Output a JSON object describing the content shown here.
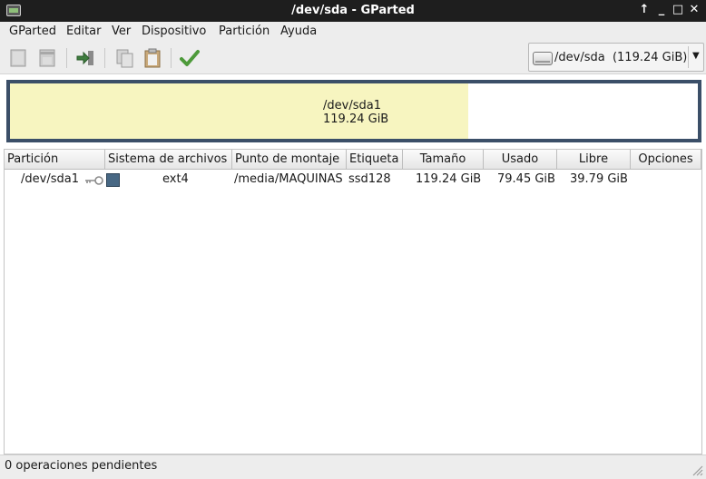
{
  "window": {
    "title": "/dev/sda - GParted",
    "controls": [
      "↑",
      "_",
      "□",
      "✕"
    ]
  },
  "menu": {
    "items": [
      "GParted",
      "Editar",
      "Ver",
      "Dispositivo",
      "Partición",
      "Ayuda"
    ]
  },
  "toolbar": {
    "buttons": [
      "new-partition-icon",
      "delete-partition-icon",
      "resize-move-icon",
      "copy-icon",
      "paste-icon",
      "apply-icon"
    ]
  },
  "device_selector": {
    "label": "/dev/sda  (119.24 GiB)"
  },
  "graphic": {
    "partition_name": "/dev/sda1",
    "partition_size": "119.24 GiB",
    "used_fraction": 0.666,
    "color_partition": "#f7f5c0",
    "color_frame": "#3b4f68"
  },
  "table": {
    "columns": [
      "Partición",
      "Sistema de archivos",
      "Punto de montaje",
      "Etiqueta",
      "Tamaño",
      "Usado",
      "Libre",
      "Opciones"
    ],
    "rows": [
      {
        "partition": "/dev/sda1",
        "mounted": true,
        "filesystem": "ext4",
        "filesystem_color": "#486884",
        "mountpoint": "/media/MAQUINAS",
        "label": "ssd128",
        "size": "119.24 GiB",
        "used": "79.45 GiB",
        "free": "39.79 GiB",
        "flags": ""
      }
    ]
  },
  "status": {
    "text": "0 operaciones pendientes"
  }
}
